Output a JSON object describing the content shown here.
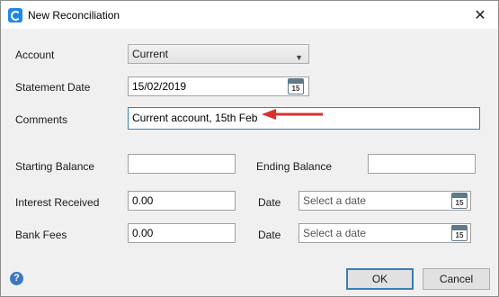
{
  "window": {
    "title": "New Reconciliation",
    "close_glyph": "✕"
  },
  "form": {
    "account_label": "Account",
    "account_value": "Current",
    "statement_date_label": "Statement Date",
    "statement_date_value": "15/02/2019",
    "comments_label": "Comments",
    "comments_value": "Current account, 15th Feb",
    "starting_balance_label": "Starting Balance",
    "starting_balance_value": "",
    "ending_balance_label": "Ending Balance",
    "ending_balance_value": "",
    "interest_received_label": "Interest Received",
    "interest_received_value": "0.00",
    "interest_date_label": "Date",
    "interest_date_placeholder": "Select a date",
    "bank_fees_label": "Bank Fees",
    "bank_fees_value": "0.00",
    "fees_date_label": "Date",
    "fees_date_placeholder": "Select a date",
    "calendar_day": "15"
  },
  "buttons": {
    "ok": "OK",
    "cancel": "Cancel",
    "help": "?"
  },
  "icons": {
    "app": "app-logo-icon",
    "calendar": "calendar-icon",
    "dropdown": "chevron-down-icon",
    "annotation": "red-arrow-icon",
    "help": "help-icon"
  },
  "colors": {
    "arrow": "#d9302c",
    "app_icon": "#1e88e5",
    "help": "#3a78c4",
    "focus_border": "#3c7fb1"
  }
}
